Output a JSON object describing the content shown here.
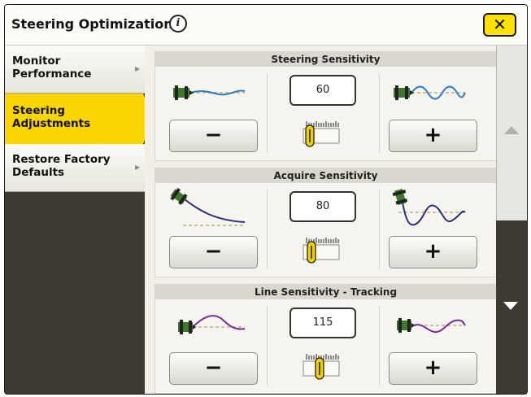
{
  "window": {
    "title": "Steering Optimization",
    "close_label": "✕"
  },
  "nav": {
    "items": [
      {
        "label": "Monitor\nPerformance",
        "active": false
      },
      {
        "label": "Steering\nAdjustments",
        "active": true
      },
      {
        "label": "Restore Factory\nDefaults",
        "active": false
      }
    ]
  },
  "panels": [
    {
      "title": "Steering Sensitivity",
      "value": "60",
      "minus_label": "−",
      "plus_label": "+",
      "level": 0.1
    },
    {
      "title": "Acquire Sensitivity",
      "value": "80",
      "minus_label": "−",
      "plus_label": "+",
      "level": 0.15
    },
    {
      "title": "Line Sensitivity - Tracking",
      "value": "115",
      "minus_label": "−",
      "plus_label": "+",
      "level": 0.4
    }
  ],
  "icons": {
    "info": "info-icon",
    "close": "close-icon",
    "scroll_up": "scroll-up-arrow-icon",
    "scroll_down": "scroll-down-arrow-icon",
    "nav_arrow": "chevron-right-icon"
  },
  "colors": {
    "accent": "#fbd500",
    "tractor": "#3a7a2a",
    "line_blue": "#2a7dc0",
    "line_navy": "#2b2f7a",
    "line_purple": "#7a2a9a",
    "guide": "#c9c39a"
  }
}
